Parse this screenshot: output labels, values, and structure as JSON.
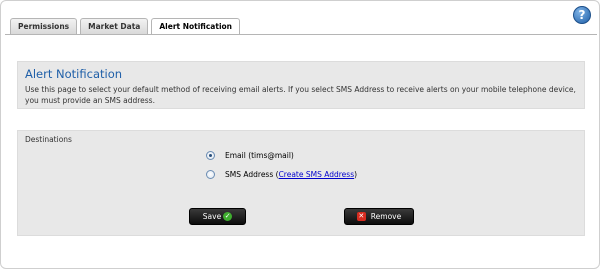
{
  "tabs": [
    {
      "label": "Permissions",
      "active": false
    },
    {
      "label": "Market Data",
      "active": false
    },
    {
      "label": "Alert Notification",
      "active": true
    }
  ],
  "help": {
    "glyph": "?",
    "icon": "help-icon"
  },
  "header": {
    "title": "Alert Notification",
    "description": "Use this page to select your default method of receiving email alerts. If you select SMS Address to receive alerts on your mobile telephone device, you must provide an SMS address."
  },
  "destinations": {
    "label": "Destinations",
    "options": [
      {
        "label": "Email (tims@mail)",
        "selected": true
      },
      {
        "label_prefix": "SMS Address (",
        "link": "Create SMS Address",
        "label_suffix": ")",
        "selected": false
      }
    ]
  },
  "buttons": {
    "save": "Save",
    "remove": "Remove"
  },
  "colors": {
    "accent": "#1f5fa8",
    "panel": "#e8e8e8",
    "button": "#1a1a1a",
    "save_icon": "#3fae2f",
    "remove_icon": "#d62b1f"
  }
}
